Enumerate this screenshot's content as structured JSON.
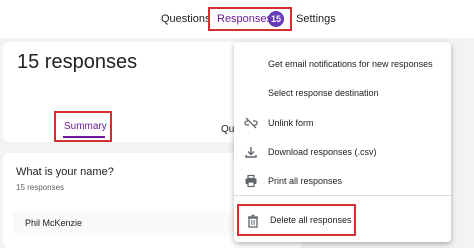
{
  "tabs": {
    "questions": "Questions",
    "responses": "Responses",
    "responses_count": "15",
    "settings": "Settings"
  },
  "summary_card": {
    "title": "15 responses",
    "summary_tab": "Summary",
    "question_tab_partial": "Qu"
  },
  "question_card": {
    "question": "What is your name?",
    "count": "15 responses",
    "answer": "Phil McKenzie"
  },
  "menu": {
    "items": [
      {
        "label": "Get email notifications for new responses",
        "icon": "none"
      },
      {
        "label": "Select response destination",
        "icon": "none"
      },
      {
        "label": "Unlink form",
        "icon": "link-off-icon"
      },
      {
        "label": "Download responses (.csv)",
        "icon": "download-icon"
      },
      {
        "label": "Print all responses",
        "icon": "print-icon"
      },
      {
        "label": "Delete all responses",
        "icon": "trash-icon"
      }
    ]
  },
  "colors": {
    "accent": "#673ab7",
    "highlight": "#d32f2f"
  }
}
